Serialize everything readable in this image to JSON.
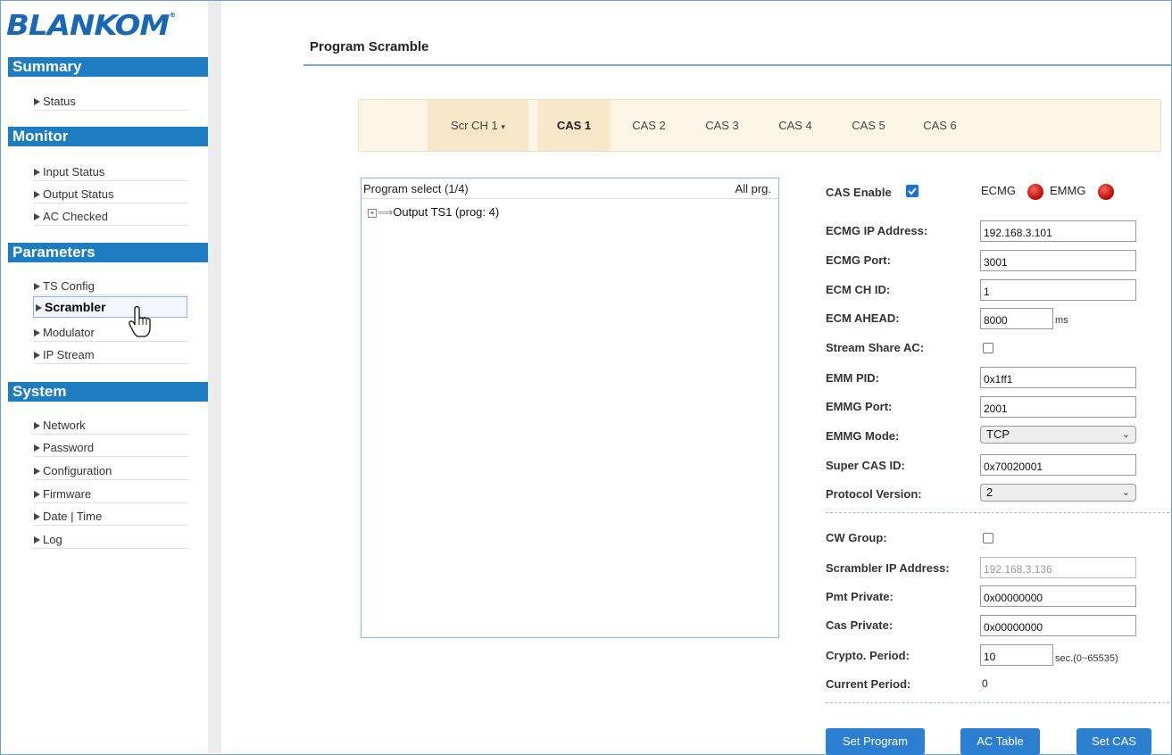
{
  "logo": {
    "text": "BLANKOM",
    "mark": "®"
  },
  "sidebar": {
    "sections": [
      {
        "title": "Summary",
        "items": [
          "Status"
        ]
      },
      {
        "title": "Monitor",
        "items": [
          "Input Status",
          "Output Status",
          "AC Checked"
        ]
      },
      {
        "title": "Parameters",
        "items": [
          "TS Config",
          "Scrambler",
          "Modulator",
          "IP Stream"
        ]
      },
      {
        "title": "System",
        "items": [
          "Network",
          "Password",
          "Configuration",
          "Firmware",
          "Date | Time",
          "Log"
        ]
      }
    ],
    "active_item": "Scrambler"
  },
  "page": {
    "title": "Program Scramble"
  },
  "tabs": {
    "scr_channel": "Scr CH 1",
    "cas": [
      "CAS 1",
      "CAS 2",
      "CAS 3",
      "CAS 4",
      "CAS 5",
      "CAS 6"
    ],
    "active_cas": "CAS 1"
  },
  "program_select": {
    "header": "Program select (1/4)",
    "all_label": "All prg.",
    "tree": [
      {
        "label": "Output TS1 (prog: 4)"
      }
    ]
  },
  "form": {
    "cas_enable_label": "CAS Enable",
    "cas_enable": true,
    "ecmg_label": "ECMG",
    "emmg_label": "EMMG",
    "ecmg_ip_label": "ECMG IP Address:",
    "ecmg_ip": "192.168.3.101",
    "ecmg_port_label": "ECMG Port:",
    "ecmg_port": "3001",
    "ecm_ch_id_label": "ECM CH ID:",
    "ecm_ch_id": "1",
    "ecm_ahead_label": "ECM AHEAD:",
    "ecm_ahead": "8000",
    "ecm_ahead_unit": "ms",
    "stream_share_label": "Stream Share AC:",
    "stream_share": false,
    "emm_pid_label": "EMM PID:",
    "emm_pid": "0x1ff1",
    "emmg_port_label": "EMMG Port:",
    "emmg_port": "2001",
    "emmg_mode_label": "EMMG Mode:",
    "emmg_mode": "TCP",
    "super_cas_label": "Super CAS ID:",
    "super_cas": "0x70020001",
    "protocol_label": "Protocol Version:",
    "protocol": "2",
    "cw_group_label": "CW Group:",
    "cw_group": false,
    "scrambler_ip_label": "Scrambler IP Address:",
    "scrambler_ip": "192.168.3.136",
    "pmt_private_label": "Pmt Private:",
    "pmt_private": "0x00000000",
    "cas_private_label": "Cas Private:",
    "cas_private": "0x00000000",
    "crypto_label": "Crypto. Period:",
    "crypto": "10",
    "crypto_unit": "sec.(0~65535)",
    "current_period_label": "Current Period:",
    "current_period": "0"
  },
  "buttons": {
    "set_program": "Set Program",
    "ac_table": "AC Table",
    "set_cas": "Set CAS"
  },
  "colors": {
    "accent": "#1e7cc1",
    "button": "#2c7ed0",
    "tab_bg": "#fdf5e6",
    "led": "#c41010"
  }
}
